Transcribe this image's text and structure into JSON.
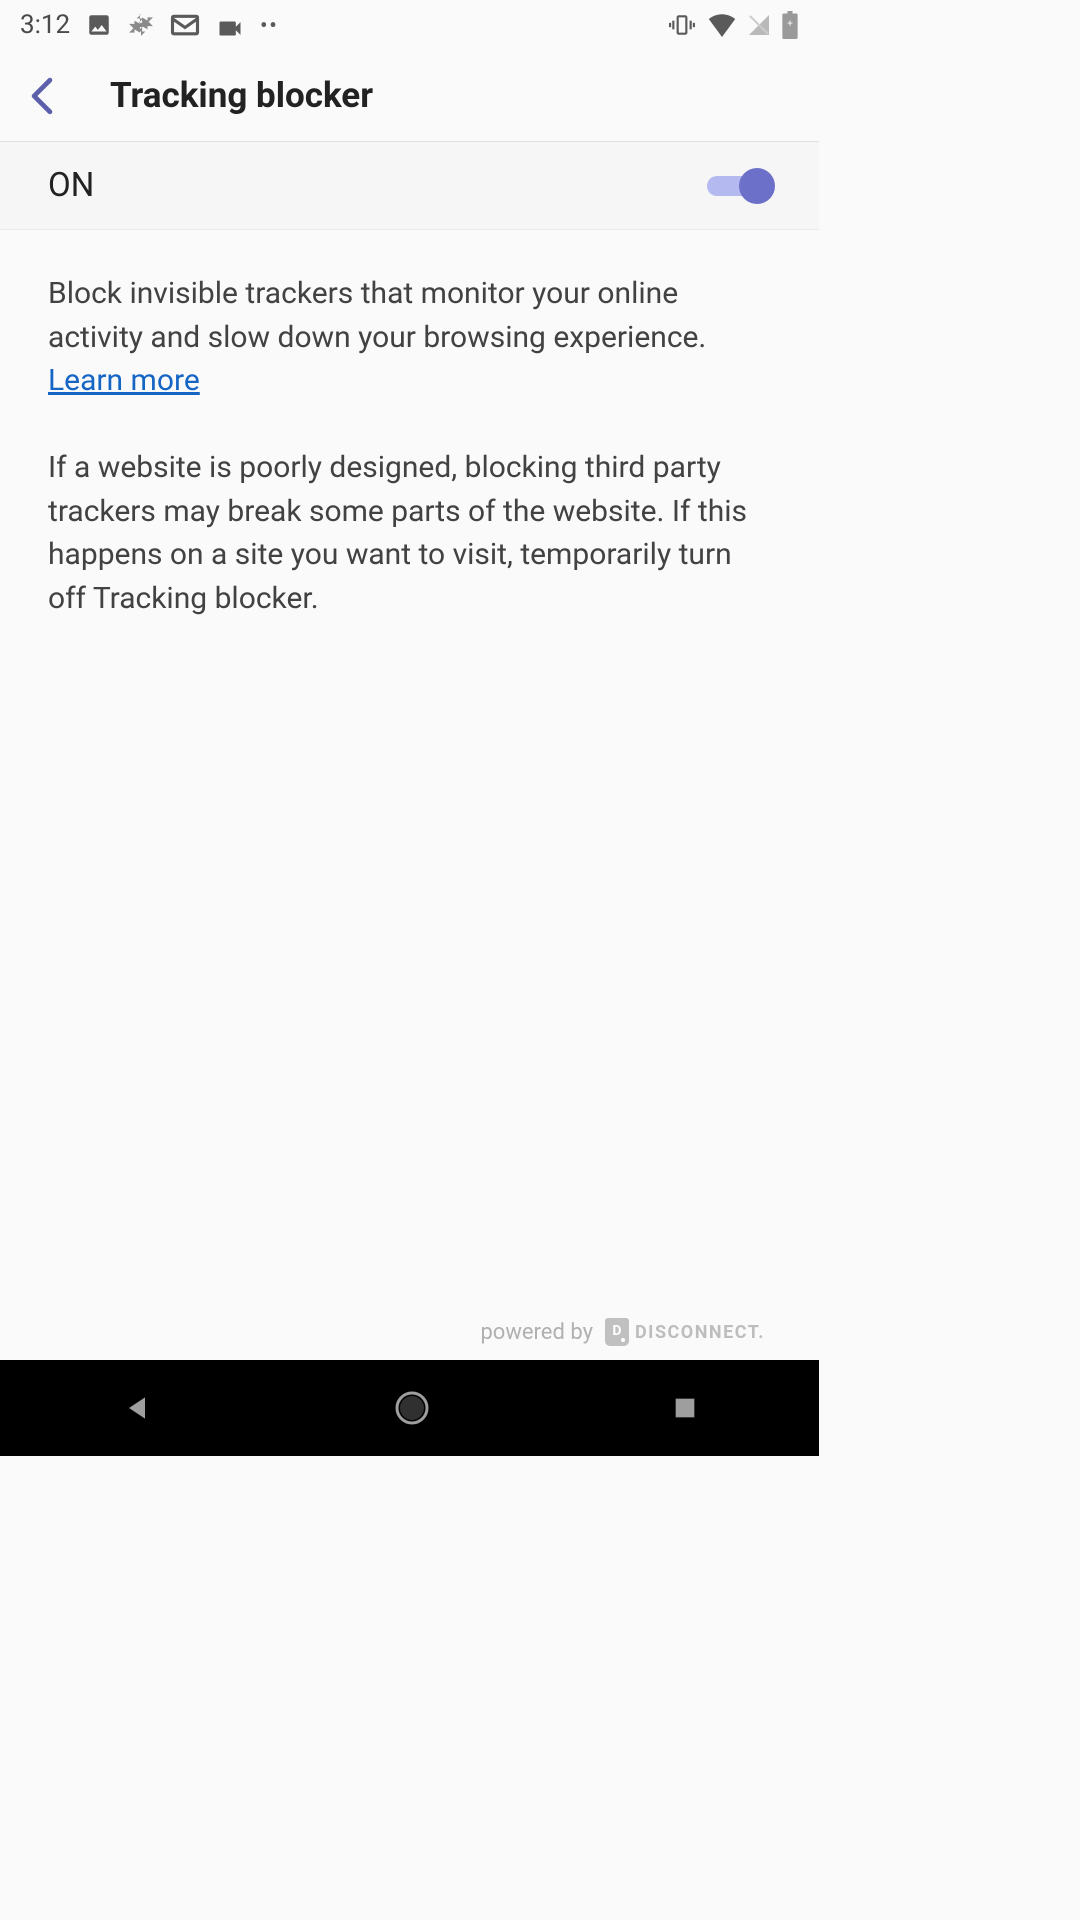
{
  "status_bar": {
    "time": "3:12"
  },
  "header": {
    "title": "Tracking blocker"
  },
  "toggle": {
    "label": "ON",
    "state": true
  },
  "content": {
    "description": "Block invisible trackers that monitor your online activity and slow down your browsing experience.",
    "learn_more": "Learn more",
    "paragraph_2": "If a website is poorly designed, blocking third party trackers may break some parts of the website. If this happens on a site you want to visit, temporarily turn off Tracking blocker."
  },
  "footer": {
    "powered_by": "powered by",
    "disconnect": "DISCONNECT."
  }
}
